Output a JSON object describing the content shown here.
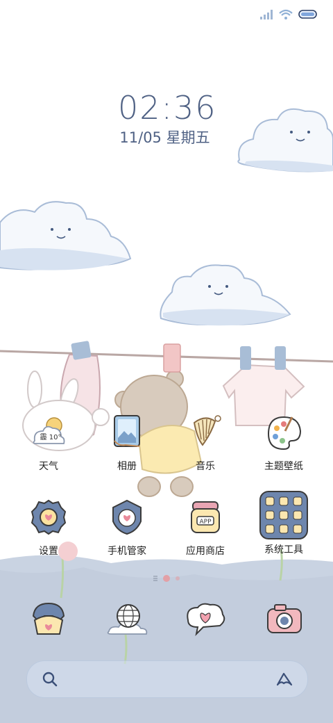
{
  "status_bar": {
    "icons": [
      "signal-icon",
      "wifi-icon",
      "battery-icon"
    ]
  },
  "lockscreen_widget": {
    "time": "02:36",
    "date": "11/05 星期五"
  },
  "weather_widget": {
    "condition": "霾",
    "temperature": "10°"
  },
  "home_apps": [
    {
      "label": "天气",
      "icon": "weather-icon"
    },
    {
      "label": "相册",
      "icon": "photo-album-icon"
    },
    {
      "label": "音乐",
      "icon": "harp-music-icon"
    },
    {
      "label": "主题壁纸",
      "icon": "palette-icon"
    },
    {
      "label": "设置",
      "icon": "settings-gear-icon"
    },
    {
      "label": "手机管家",
      "icon": "security-shield-icon"
    },
    {
      "label": "应用商店",
      "icon": "app-store-jar-icon"
    },
    {
      "label": "系统工具",
      "icon": "system-tools-folder-icon"
    }
  ],
  "page_indicator": {
    "pages": 2,
    "current": 1
  },
  "dock": [
    {
      "icon": "phone-icon"
    },
    {
      "icon": "browser-globe-icon"
    },
    {
      "icon": "messages-heart-icon"
    },
    {
      "icon": "camera-icon"
    }
  ],
  "search_bar": {
    "icons": [
      "search-icon",
      "assistant-icon"
    ]
  },
  "colors": {
    "clock_text": "#4f6184",
    "sky_cloud": "#dfe7f4",
    "grass": "#c9d3e2",
    "accent_pink": "#f2b8be"
  }
}
